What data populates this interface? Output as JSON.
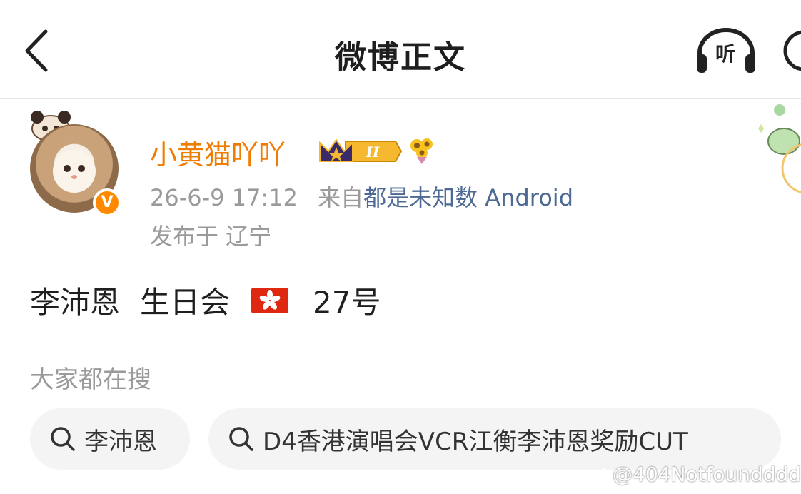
{
  "nav": {
    "title": "微博正文",
    "listen_label": "听"
  },
  "author": {
    "username": "小黄猫吖吖",
    "crown_level": "II",
    "verified_mark": "V",
    "timestamp": "26-6-9 17:12",
    "source_prefix": "来自",
    "source": "都是未知数 Android",
    "location": "发布于 辽宁"
  },
  "post": {
    "text_part1": "李沛恩",
    "text_part2": "生日会",
    "flag_emoji": "hong-kong-flag",
    "text_part3": "27号"
  },
  "search": {
    "section_title": "大家都在搜",
    "chips": [
      {
        "label": "李沛恩"
      },
      {
        "label": "D4香港演唱会VCR江衡李沛恩奖励CUT"
      }
    ]
  },
  "watermark": {
    "text": "@404Notfoundddd-"
  },
  "colors": {
    "username": "#f07c00",
    "source_link": "#4e6a94",
    "meta_gray": "#9a9a9a",
    "verified_badge": "#ff8a00",
    "chip_bg": "#f4f4f4"
  },
  "icons": [
    "back-arrow-icon",
    "listen-headphones-icon",
    "more-icon",
    "crown-icon",
    "sunflower-icon",
    "search-icon",
    "weibo-logo-icon"
  ]
}
